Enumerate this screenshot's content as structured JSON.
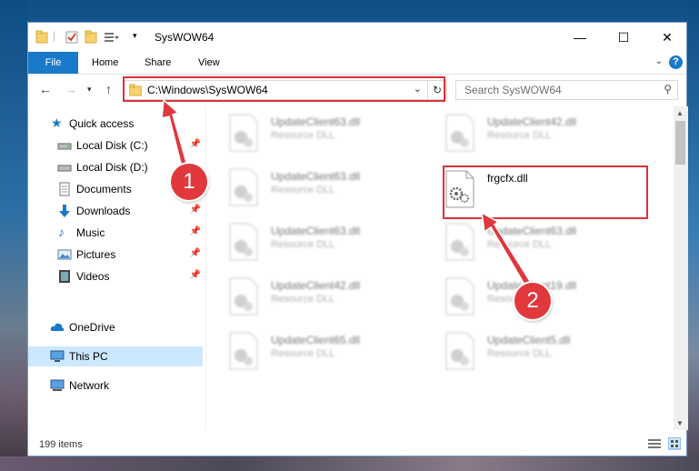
{
  "window": {
    "title": "SysWOW64",
    "minimize": "—",
    "maximize": "☐",
    "close": "✕"
  },
  "ribbon": {
    "file": "File",
    "home": "Home",
    "share": "Share",
    "view": "View",
    "help": "?"
  },
  "navbar": {
    "address": "C:\\Windows\\SysWOW64",
    "search_placeholder": "Search SysWOW64"
  },
  "sidebar": {
    "items": [
      {
        "label": "Quick access",
        "icon": "star-icon"
      },
      {
        "label": "Local Disk (C:)",
        "icon": "drive-icon",
        "pinned": true
      },
      {
        "label": "Local Disk (D:)",
        "icon": "drive-icon"
      },
      {
        "label": "Documents",
        "icon": "document-icon",
        "pinned": true
      },
      {
        "label": "Downloads",
        "icon": "download-icon",
        "pinned": true
      },
      {
        "label": "Music",
        "icon": "music-icon",
        "pinned": true
      },
      {
        "label": "Pictures",
        "icon": "pictures-icon",
        "pinned": true
      },
      {
        "label": "Videos",
        "icon": "videos-icon",
        "pinned": true
      },
      {
        "label": "OneDrive",
        "icon": "cloud-icon"
      },
      {
        "label": "This PC",
        "icon": "computer-icon",
        "selected": true
      },
      {
        "label": "Network",
        "icon": "network-icon"
      }
    ]
  },
  "files": [
    {
      "name": "UpdateClient63.dll",
      "type": "Resource DLL",
      "blurred": true
    },
    {
      "name": "UpdateClient42.dll",
      "type": "Resource DLL",
      "blurred": true
    },
    {
      "name": "UpdateClient63.dll",
      "type": "Resource DLL",
      "blurred": true
    },
    {
      "name": "frgcfx.dll",
      "type": "",
      "blurred": false
    },
    {
      "name": "UpdateClient63.dll",
      "type": "Resource DLL",
      "blurred": true
    },
    {
      "name": "UpdateClient63.dll",
      "type": "Resource DLL",
      "blurred": true
    },
    {
      "name": "UpdateClient42.dll",
      "type": "Resource DLL",
      "blurred": true
    },
    {
      "name": "UpdateClient19.dll",
      "type": "Resource DLL",
      "blurred": true
    },
    {
      "name": "UpdateClient65.dll",
      "type": "Resource DLL",
      "blurred": true
    },
    {
      "name": "UpdateClient5.dll",
      "type": "Resource DLL",
      "blurred": true
    }
  ],
  "status": {
    "item_count": "199 items"
  },
  "annotations": {
    "step1": "1",
    "step2": "2",
    "highlight_color": "#d9343a"
  },
  "colors": {
    "accent": "#1979ca",
    "selected_bg": "#cce8ff"
  }
}
